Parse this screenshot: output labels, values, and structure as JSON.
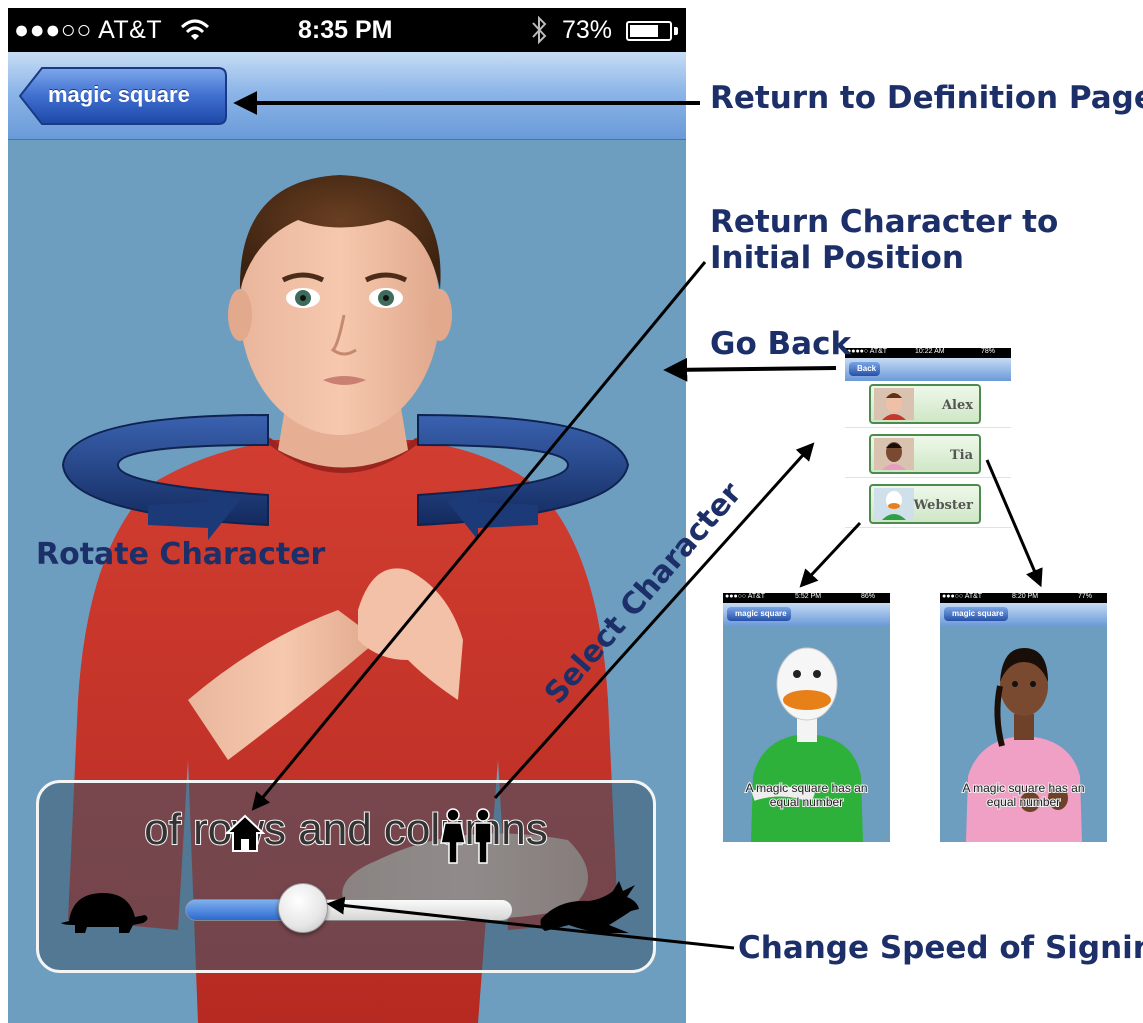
{
  "status_bar": {
    "carrier": "●●●○○ AT&T",
    "time": "8:35 PM",
    "battery": "73%",
    "battery_level": 0.73
  },
  "nav": {
    "back_label": "magic square"
  },
  "player": {
    "caption": "of rows and columns",
    "speed_level": 0.36
  },
  "annotations": {
    "return_definition": "Return to Definition Page",
    "return_position_line1": "Return Character to",
    "return_position_line2": "Initial Position",
    "go_back": "Go Back",
    "rotate": "Rotate Character",
    "select": "Select Character",
    "speed": "Change Speed of Signing"
  },
  "character_picker": {
    "status_left": "●●●●○ AT&T",
    "status_time": "10:22 AM",
    "status_battery": "78%",
    "back_label": "Back",
    "characters": [
      "Alex",
      "Tia",
      "Webster"
    ]
  },
  "duck_screen": {
    "status_left": "●●●○○ AT&T",
    "status_time": "5:52 PM",
    "status_battery": "86%",
    "back_label": "magic square",
    "caption_line1": "A magic square has an",
    "caption_line2": "equal number"
  },
  "tia_screen": {
    "status_left": "●●●○○ AT&T",
    "status_time": "8:20 PM",
    "status_battery": "77%",
    "back_label": "magic square",
    "caption_line1": "A magic square has an",
    "caption_line2": "equal number"
  },
  "colors": {
    "annotation": "#1c2f68",
    "background_blue": "#6d9ec0",
    "shirt_red": "#c8362a",
    "rotate_arrow": "#1d3a78"
  }
}
